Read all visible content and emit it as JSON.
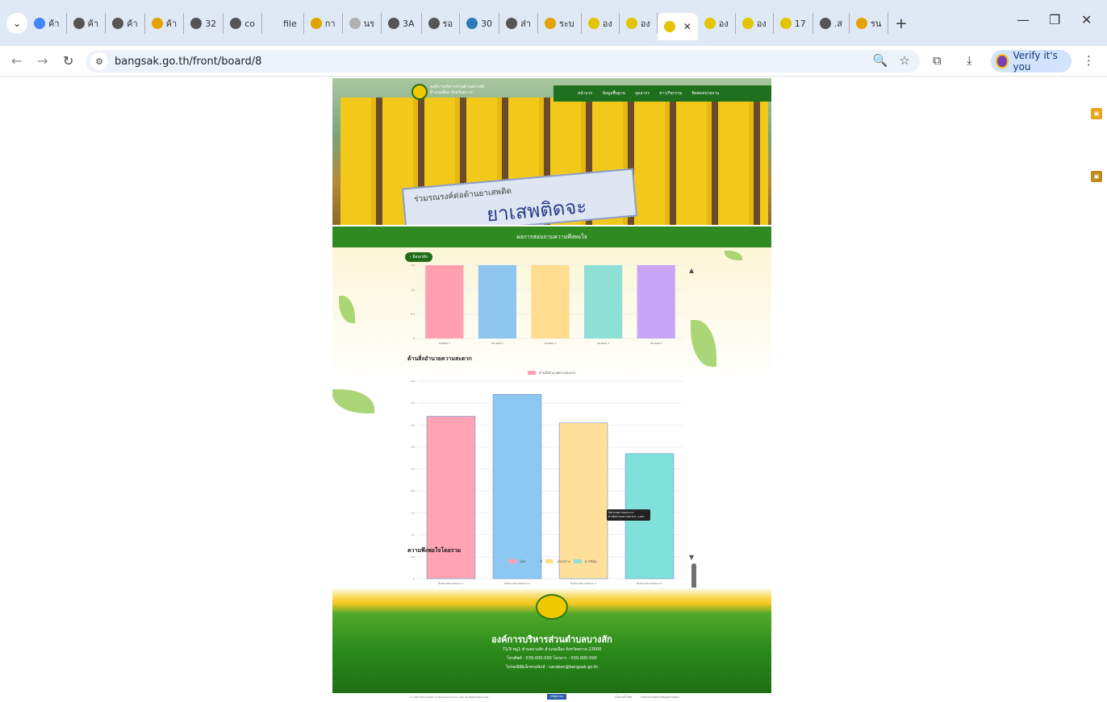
{
  "browser": {
    "tabs": [
      {
        "label": "ค้า",
        "fav": "#4285f4",
        "icon": "google-icon"
      },
      {
        "label": "ค้า",
        "fav": "#555",
        "icon": "globe-icon"
      },
      {
        "label": "ค้า",
        "fav": "#555",
        "icon": "globe-icon"
      },
      {
        "label": "ค้า",
        "fav": "#e2a200",
        "icon": "org-logo-icon"
      },
      {
        "label": "32",
        "fav": "#555",
        "icon": "globe-icon"
      },
      {
        "label": "co",
        "fav": "#555",
        "icon": "globe-icon"
      },
      {
        "label": "file",
        "fav": "#dfe8f5",
        "icon": "file-icon"
      },
      {
        "label": "กา",
        "fav": "#e2a200",
        "icon": "org-logo-icon"
      },
      {
        "label": "นร",
        "fav": "#b0b0b0",
        "icon": "org-logo-icon"
      },
      {
        "label": "3A",
        "fav": "#555",
        "icon": "globe-icon"
      },
      {
        "label": "รอ",
        "fav": "#555",
        "icon": "globe-icon"
      },
      {
        "label": "30",
        "fav": "#2c7bb6",
        "icon": "wordpress-icon"
      },
      {
        "label": "ส่า",
        "fav": "#555",
        "icon": "globe-icon"
      },
      {
        "label": "ระบ",
        "fav": "#e2a200",
        "icon": "org-logo-icon"
      },
      {
        "label": "อง",
        "fav": "#e2c400",
        "icon": "org-logo-icon"
      },
      {
        "label": "อง",
        "fav": "#e2c400",
        "icon": "org-logo-icon"
      },
      {
        "label": "",
        "fav": "#e2c400",
        "icon": "org-logo-icon",
        "active": true
      },
      {
        "label": "อง",
        "fav": "#e2c400",
        "icon": "org-logo-icon"
      },
      {
        "label": "อง",
        "fav": "#e2c400",
        "icon": "org-logo-icon"
      },
      {
        "label": "17",
        "fav": "#e2c400",
        "icon": "org-logo-icon"
      },
      {
        "label": ".ส",
        "fav": "#555",
        "icon": "globe-icon"
      },
      {
        "label": "รน",
        "fav": "#e2a200",
        "icon": "org-logo-icon"
      }
    ],
    "url": "bangsak.go.th/front/board/8",
    "verify_label": "Verify it's you"
  },
  "site": {
    "header_title_1": "องค์การบริหารส่วนตำบลบางสัก",
    "header_title_2": "อำเภอเมือง จังหวัดตราด",
    "nav": [
      "หน้าแรก",
      "ข้อมูลพื้นฐาน",
      "บุคลากร",
      "ข่าว/กิจกรรม",
      "ติดต่อหน่วยงาน"
    ],
    "banner_small": "ร่วมรณรงค์ต่อต้านยาเสพติด",
    "banner_big": "ยาเสพติดจะพินาศ",
    "section_title": "ผลการสอบถามความพึงพอใจ",
    "back_button": "‹ ย้อนกลับ"
  },
  "chart_data": [
    {
      "type": "bar",
      "categories": [
        "หมวดหมู่ 1",
        "หมวดหมู่ 2",
        "หมวดหมู่ 3",
        "หมวดหมู่ 4",
        "หมวดหมู่ 5"
      ],
      "values": [
        1.5,
        1.5,
        1.5,
        1.5,
        1.5
      ],
      "ylim": [
        0,
        1.5
      ],
      "yticks": [
        "0",
        "0.5",
        "1.0",
        "1.5"
      ],
      "colors": [
        "#ff9fb0",
        "#8ec6ef",
        "#ffdc8e",
        "#8edfd5",
        "#c8a6f5"
      ]
    },
    {
      "type": "bar",
      "title": "ด้านสิ่งอำนวยความสะดวก",
      "legend": [
        "ด้านสิ่งอำนวยความสะดวก"
      ],
      "categories": [
        "สิ่งอำนวยความสะดวก 1",
        "สิ่งอำนวยความสะดวก 2",
        "สิ่งอำนวยความสะดวก 3",
        "สิ่งอำนวยความสะดวก 4"
      ],
      "values": [
        3.7,
        4.2,
        3.55,
        2.85
      ],
      "ylim": [
        0,
        4.5
      ],
      "yticks": [
        "0",
        "0.5",
        "1.0",
        "1.5",
        "2.0",
        "2.5",
        "3.0",
        "3.5",
        "4.0",
        "4.5"
      ],
      "colors": [
        "#ffa3b5",
        "#8dc8f2",
        "#ffe09a",
        "#7fe0dc"
      ],
      "tooltip": [
        "สิ่งอำนวยความสะดวก 4",
        "ด้านสิ่งอำนวยความสะดวก: 2.857"
      ]
    }
  ],
  "satisfaction": {
    "title": "ความพึงพอใจโดยรวม",
    "legend": [
      {
        "label": "น้อย",
        "color": "#ff9fb0"
      },
      {
        "label": "ดี",
        "color": "#8ec6ef"
      },
      {
        "label": "ปานกลาง",
        "color": "#ffdc8e"
      },
      {
        "label": "มากที่สุด",
        "color": "#8edfd5"
      }
    ]
  },
  "footer": {
    "title": "องค์การบริหารส่วนตำบลบางสัก",
    "address": "71/9 หมู่1 ตำบลบางสัก อำเภอเมือง จังหวัดตราด 23000",
    "phone": "โทรศัพท์ : 039-000-000 โทรสาร : 039-000-000",
    "email": "ไปรษณีย์อิเล็กทรอนิกส์ : saraban@bangsak.go.th",
    "copyright": "© 2025 Site System & Development Co.,Ltd. All Rights Reserved.",
    "counter": "สถิติผู้เข้าชม",
    "links": [
      "นโยบายเว็บไซต์",
      "นโยบายการคุ้มครองข้อมูลส่วนบุคคล"
    ]
  }
}
